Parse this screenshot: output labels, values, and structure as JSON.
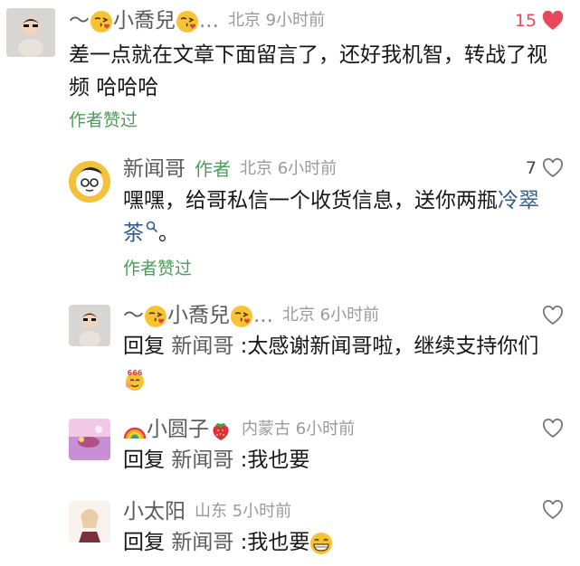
{
  "comments": [
    {
      "name_prefix": "～",
      "name_main": "小喬兒",
      "name_ellipsis": "...",
      "location": "北京",
      "time": "9小时前",
      "likes": "15",
      "text": "差一点就在文章下面留言了，还好我机智，转战了视频 哈哈哈",
      "author_liked": "作者赞过"
    }
  ],
  "reply_author": {
    "name": "新闻哥",
    "tag": "作者",
    "location": "北京",
    "time": "6小时前",
    "likes": "7",
    "text_before": "嘿嘿，给哥私信一个收货信息，送你两瓶",
    "link_text": "冷翠茶",
    "text_after": "。",
    "author_liked": "作者赞过"
  },
  "sub_replies": [
    {
      "name_prefix": "～",
      "name_main": "小喬兒",
      "name_ellipsis": "...",
      "location": "北京",
      "time": "6小时前",
      "reply_label": "回复",
      "reply_to": "新闻哥",
      "text": ":太感谢新闻哥啦，继续支持你们"
    },
    {
      "name_main": "小圆子",
      "location": "内蒙古",
      "time": "6小时前",
      "reply_label": "回复",
      "reply_to": "新闻哥",
      "text": ":我也要"
    },
    {
      "name_main": "小太阳",
      "location": "山东",
      "time": "5小时前",
      "reply_label": "回复",
      "reply_to": "新闻哥",
      "text": ":我也要"
    }
  ],
  "colors": {
    "like_red": "#e9485c",
    "author_green": "#4a9e5a",
    "link_blue": "#2e5a8c"
  },
  "icons": [
    "heart-filled-icon",
    "heart-outline-icon",
    "search-icon",
    "kiss-emoji-icon",
    "grin-emoji-icon",
    "666-emoji-icon",
    "rainbow-emoji-icon",
    "strawberry-emoji-icon"
  ]
}
